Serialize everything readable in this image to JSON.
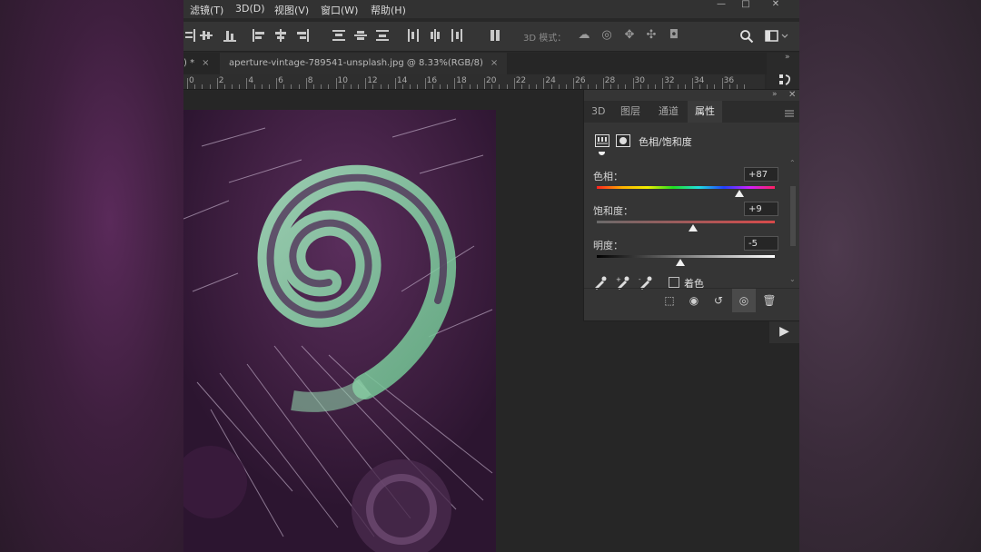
{
  "menu": {
    "items": [
      {
        "label": "滤镜(T)"
      },
      {
        "label": "3D(D)"
      },
      {
        "label": "视图(V)"
      },
      {
        "label": "窗口(W)"
      },
      {
        "label": "帮助(H)"
      }
    ]
  },
  "window_controls": {
    "minimize": "—",
    "maximize": "□",
    "close": "✕"
  },
  "options_bar": {
    "mode_3d_label": "3D 模式："
  },
  "document": {
    "prev_tab_label": ") *",
    "tab_label": "aperture-vintage-789541-unsplash.jpg @ 8.33%(RGB/8)",
    "close_symbol": "×"
  },
  "ruler": {
    "ticks": [
      "0",
      "2",
      "4",
      "6",
      "8",
      "10",
      "12",
      "14",
      "16",
      "18",
      "20",
      "22",
      "24",
      "26",
      "28",
      "30",
      "32",
      "34",
      "36"
    ]
  },
  "panel": {
    "tabs": [
      {
        "label": "3D"
      },
      {
        "label": "图层"
      },
      {
        "label": "通道"
      },
      {
        "label": "属性"
      }
    ],
    "active_tab": "属性",
    "title": "色相/饱和度",
    "hue": {
      "label": "色相：",
      "value": "+87",
      "position": 0.8
    },
    "saturation": {
      "label": "饱和度：",
      "value": "+9",
      "position": 0.54
    },
    "lightness": {
      "label": "明度：",
      "value": "-5",
      "position": 0.47
    },
    "colorize": {
      "label": "着色",
      "checked": false
    }
  },
  "colors": {
    "app_bg": "#282828",
    "panel_bg": "#353535",
    "image_base": "#3b1d3c",
    "swirl_green": "#8fdcae"
  }
}
